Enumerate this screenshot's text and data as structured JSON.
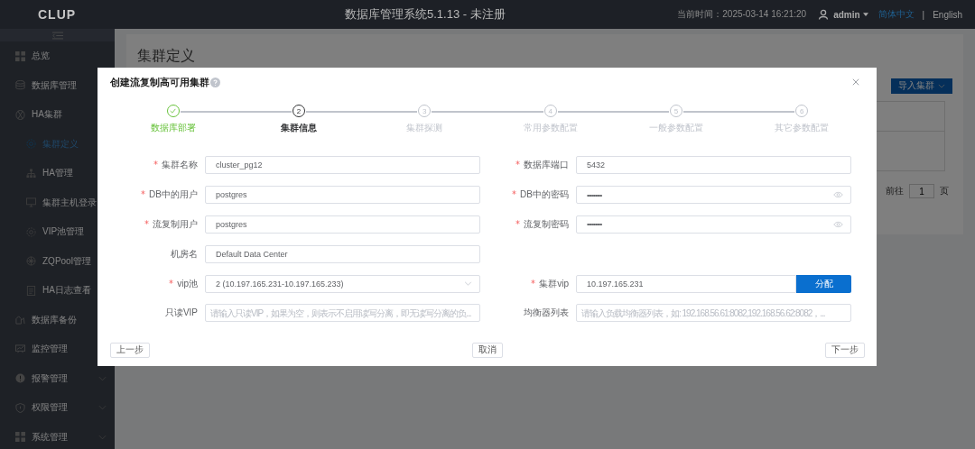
{
  "header": {
    "logo": "CLUP",
    "title": "数据库管理系统5.1.13 - 未注册",
    "time": "当前时间：2025-03-14 16:21:20",
    "user": "admin",
    "languages": [
      {
        "label": "简体中文",
        "selected": true
      },
      {
        "label": "English",
        "selected": false
      }
    ],
    "separator": "|"
  },
  "sidebar": {
    "items": [
      {
        "label": "总览",
        "arrow": false
      },
      {
        "label": "数据库管理"
      },
      {
        "label": "HA集群",
        "children": [
          {
            "label": "集群定义",
            "selected": true
          },
          {
            "label": "HA管理",
            "selected": false
          },
          {
            "label": "集群主机登录",
            "selected": false
          },
          {
            "label": "VIP池管理",
            "selected": false
          },
          {
            "label": "ZQPool管理",
            "selected": false
          },
          {
            "label": "HA日志查看",
            "selected": false
          }
        ]
      },
      {
        "label": "数据库备份"
      },
      {
        "label": "监控管理"
      },
      {
        "label": "报警管理",
        "arrow": true
      },
      {
        "label": "权限管理",
        "arrow": true
      },
      {
        "label": "系统管理",
        "arrow": true
      }
    ]
  },
  "page": {
    "title": "集群定义",
    "import_button": "导入集群",
    "goto_label": "前往",
    "goto_value": "1",
    "goto_unit": "页"
  },
  "dialog": {
    "title": "创建流复制高可用集群",
    "steps": [
      {
        "label": "数据库部署",
        "finished": true,
        "selected": false
      },
      {
        "number": "2",
        "label": "集群信息",
        "finished": false,
        "selected": true
      },
      {
        "number": "3",
        "label": "集群探测",
        "finished": false,
        "selected": false
      },
      {
        "number": "4",
        "label": "常用参数配置",
        "finished": false,
        "selected": false
      },
      {
        "number": "5",
        "label": "一般参数配置",
        "finished": false,
        "selected": false
      },
      {
        "number": "6",
        "label": "其它参数配置",
        "finished": false,
        "selected": false
      }
    ],
    "rows": [
      {
        "left": {
          "label": "集群名称",
          "required": true,
          "kind": "text",
          "value": "cluster_pg12"
        },
        "right": {
          "label": "数据库端口",
          "required": true,
          "kind": "text",
          "value": "5432"
        }
      },
      {
        "left": {
          "label": "DB中的用户",
          "required": true,
          "kind": "text",
          "value": "postgres"
        },
        "right": {
          "label": "DB中的密码",
          "required": true,
          "kind": "password",
          "value": "•••••••••"
        }
      },
      {
        "left": {
          "label": "流复制用户",
          "required": true,
          "kind": "text",
          "value": "postgres"
        },
        "right": {
          "label": "流复制密码",
          "required": true,
          "kind": "password",
          "value": "•••••••••"
        }
      },
      {
        "left": {
          "label": "机房名",
          "required": false,
          "kind": "text",
          "value": "Default Data Center"
        }
      },
      {
        "left": {
          "label": "vip池",
          "required": true,
          "kind": "select",
          "value": "2 (10.197.165.231-10.197.165.233)"
        },
        "right": {
          "label": "集群vip",
          "required": true,
          "kind": "button",
          "value": "10.197.165.231",
          "button": "分配"
        }
      },
      {
        "left": {
          "label": "只读VIP",
          "required": false,
          "kind": "text",
          "placeholder": "请输入只读VIP，如果为空，则表示不启用读写分离，即无读写分离的负..."
        },
        "right": {
          "label": "均衡器列表",
          "required": false,
          "kind": "text",
          "placeholder": "请输入负载均衡器列表，如: 192.168.56.61:8082,192.168.56.62:8082，..."
        }
      }
    ],
    "buttons": {
      "prev": "上一步",
      "cancel": "取消",
      "next": "下一步"
    }
  }
}
